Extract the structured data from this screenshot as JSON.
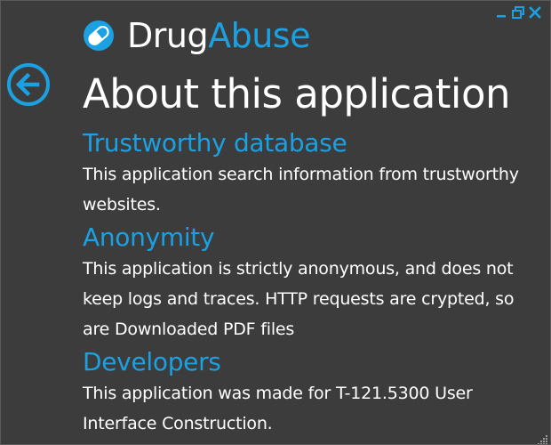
{
  "app": {
    "title_part1": "Drug",
    "title_part2": "Abuse"
  },
  "window": {
    "controls": [
      "minimize-icon",
      "restore-icon",
      "close-icon"
    ]
  },
  "page": {
    "title": "About this application"
  },
  "sections": [
    {
      "heading": "Trustworthy database",
      "text": "This application search information from trustworthy websites."
    },
    {
      "heading": "Anonymity",
      "text": "This application is strictly anonymous, and does not keep logs and traces. HTTP requests are crypted, so are Downloaded PDF files"
    },
    {
      "heading": "Developers",
      "text": "This application was made for T-121.5300 User Interface Construction."
    }
  ],
  "colors": {
    "accent": "#1ba1e2",
    "background": "#3c3c3c",
    "text": "#ffffff"
  },
  "icons": {
    "logo": "pill-icon",
    "back": "back-arrow-icon",
    "resize": "resize-grip-icon"
  }
}
